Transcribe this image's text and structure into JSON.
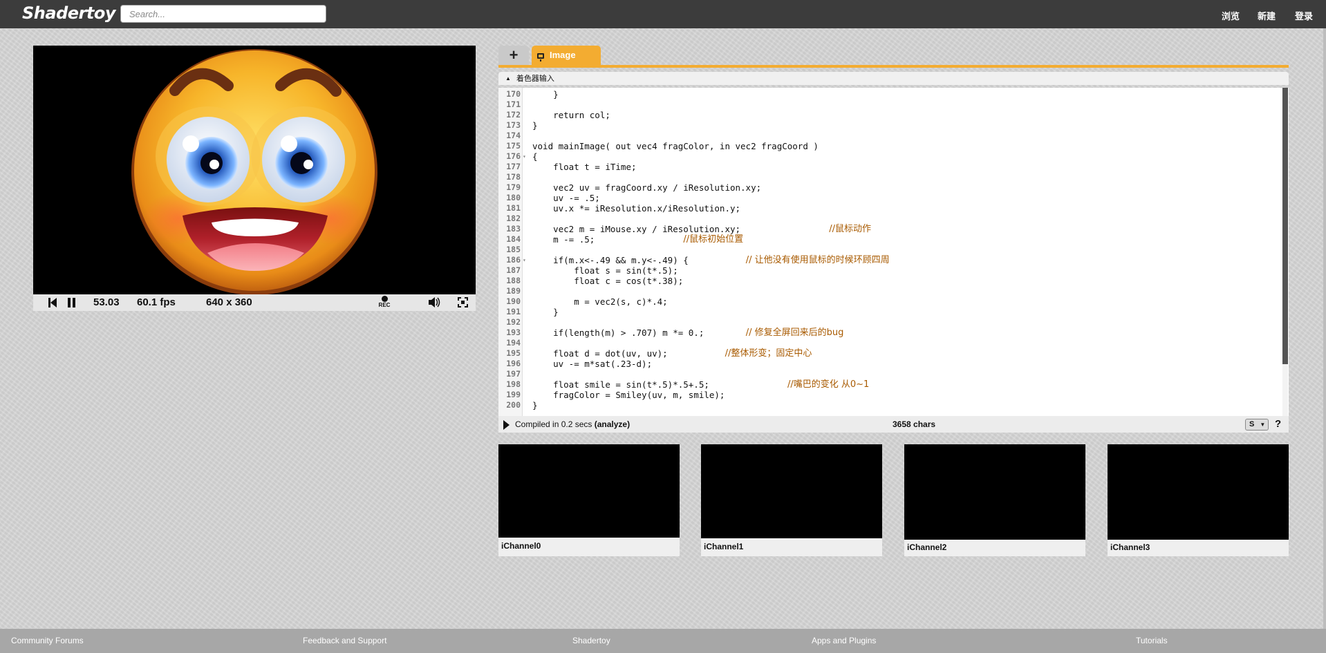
{
  "header": {
    "logo": "Shadertoy",
    "search_placeholder": "Search...",
    "nav": {
      "browse": "浏览",
      "new": "新建",
      "login": "登录"
    }
  },
  "player": {
    "time": "53.03",
    "fps": "60.1 fps",
    "resolution": "640 x 360",
    "rec_label": "REC"
  },
  "editor": {
    "tab_add": "+",
    "tab_image": "Image",
    "shader_inputs": "着色器输入",
    "code_lines": [
      {
        "n": "170",
        "t": "    }",
        "c": ""
      },
      {
        "n": "171",
        "t": "",
        "c": ""
      },
      {
        "n": "172",
        "t": "    return col;",
        "c": ""
      },
      {
        "n": "173",
        "t": "}",
        "c": ""
      },
      {
        "n": "174",
        "t": "",
        "c": ""
      },
      {
        "n": "175",
        "t": "void mainImage( out vec4 fragColor, in vec2 fragCoord )",
        "c": ""
      },
      {
        "n": "176",
        "t": "{",
        "c": "",
        "fold": true
      },
      {
        "n": "177",
        "t": "    float t = iTime;",
        "c": ""
      },
      {
        "n": "178",
        "t": "",
        "c": ""
      },
      {
        "n": "179",
        "t": "    vec2 uv = fragCoord.xy / iResolution.xy;",
        "c": ""
      },
      {
        "n": "180",
        "t": "    uv -= .5;",
        "c": ""
      },
      {
        "n": "181",
        "t": "    uv.x *= iResolution.x/iResolution.y;",
        "c": ""
      },
      {
        "n": "182",
        "t": "",
        "c": ""
      },
      {
        "n": "183",
        "t": "    vec2 m = iMouse.xy / iResolution.xy;",
        "c": "//鼠标动作",
        "ci": 57
      },
      {
        "n": "184",
        "t": "    m -= .5;",
        "c": "//鼠标初始位置",
        "ci": 29
      },
      {
        "n": "185",
        "t": "",
        "c": ""
      },
      {
        "n": "186",
        "t": "    if(m.x<-.49 && m.y<-.49) {",
        "c": "// 让他没有使用鼠标的时候环顾四周",
        "ci": 41,
        "fold": true
      },
      {
        "n": "187",
        "t": "        float s = sin(t*.5);",
        "c": ""
      },
      {
        "n": "188",
        "t": "        float c = cos(t*.38);",
        "c": ""
      },
      {
        "n": "189",
        "t": "",
        "c": ""
      },
      {
        "n": "190",
        "t": "        m = vec2(s, c)*.4;",
        "c": ""
      },
      {
        "n": "191",
        "t": "    }",
        "c": ""
      },
      {
        "n": "192",
        "t": "",
        "c": ""
      },
      {
        "n": "193",
        "t": "    if(length(m) > .707) m *= 0.;",
        "c": "// 修复全屏回来后的bug",
        "ci": 41
      },
      {
        "n": "194",
        "t": "",
        "c": ""
      },
      {
        "n": "195",
        "t": "    float d = dot(uv, uv);",
        "c": "//整体形变；固定中心",
        "ci": 37
      },
      {
        "n": "196",
        "t": "    uv -= m*sat(.23-d);",
        "c": ""
      },
      {
        "n": "197",
        "t": "",
        "c": ""
      },
      {
        "n": "198",
        "t": "    float smile = sin(t*.5)*.5+.5;",
        "c": "//嘴巴的变化 从0~1",
        "ci": 49
      },
      {
        "n": "199",
        "t": "    fragColor = Smiley(uv, m, smile);",
        "c": ""
      },
      {
        "n": "200",
        "t": "}",
        "c": ""
      }
    ],
    "compiled_text": "Compiled in 0.2 secs",
    "analyze": "(analyze)",
    "chars": "3658 chars",
    "font_size_select": "S",
    "help": "?"
  },
  "channels": [
    "iChannel0",
    "iChannel1",
    "iChannel2",
    "iChannel3"
  ],
  "footer": [
    "Community Forums",
    "Feedback and Support",
    "Shadertoy",
    "Apps and Plugins",
    "Tutorials"
  ]
}
